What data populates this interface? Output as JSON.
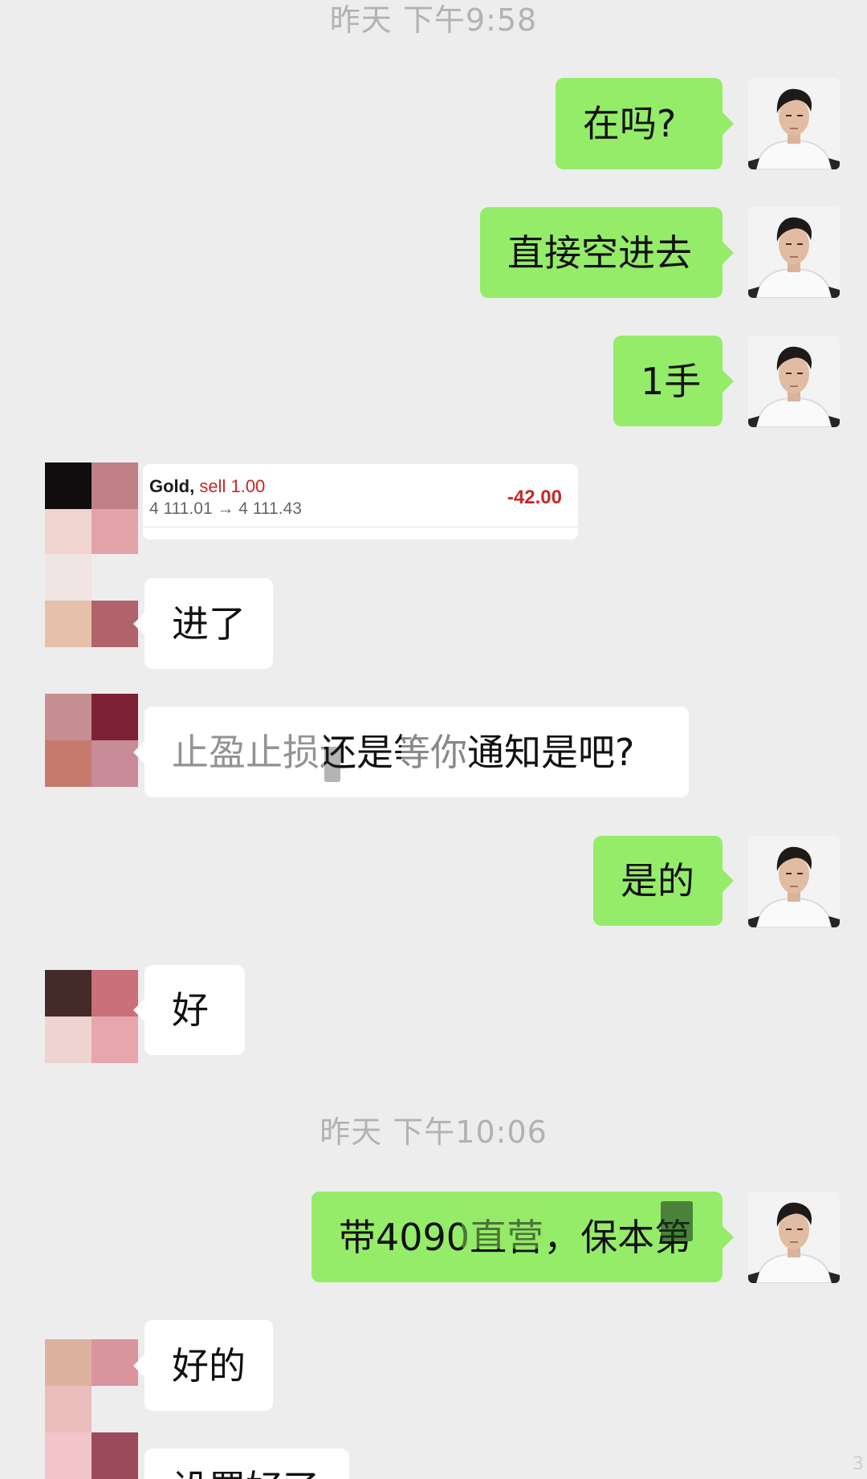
{
  "timestamps": [
    "昨天 下午9:58",
    "昨天 下午10:06"
  ],
  "messages": {
    "m1": "在吗?",
    "m2": "直接空进去",
    "m3": "1手",
    "m4": "进了",
    "m5": "止盈止损还是等你通知是吧?",
    "m6": "是的",
    "m7": "好",
    "m8": "带4090直营，保本第",
    "m9": "好的",
    "m10": "设置好了"
  },
  "trade_card": {
    "symbol": "Gold,",
    "side": "sell 1.00",
    "prices": "4 111.01 → 4 111.43",
    "pnl": "-42.00"
  },
  "colors": {
    "background": "#ededed",
    "outgoing_bubble": "#95ec69",
    "incoming_bubble": "#ffffff",
    "loss": "#c62828",
    "timestamp": "#b2b2b2"
  },
  "scroll_indicator": "3"
}
